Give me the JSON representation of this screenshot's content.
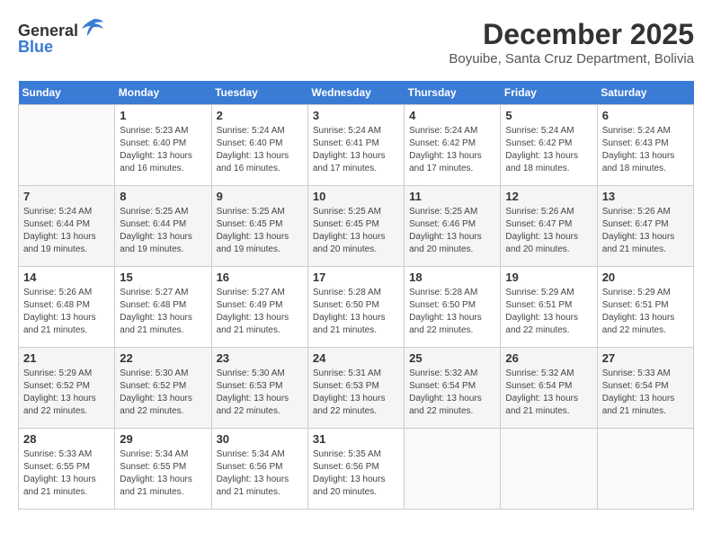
{
  "header": {
    "logo_general": "General",
    "logo_blue": "Blue",
    "month_title": "December 2025",
    "location": "Boyuibe, Santa Cruz Department, Bolivia"
  },
  "weekdays": [
    "Sunday",
    "Monday",
    "Tuesday",
    "Wednesday",
    "Thursday",
    "Friday",
    "Saturday"
  ],
  "weeks": [
    [
      {
        "day": "",
        "info": ""
      },
      {
        "day": "1",
        "info": "Sunrise: 5:23 AM\nSunset: 6:40 PM\nDaylight: 13 hours\nand 16 minutes."
      },
      {
        "day": "2",
        "info": "Sunrise: 5:24 AM\nSunset: 6:40 PM\nDaylight: 13 hours\nand 16 minutes."
      },
      {
        "day": "3",
        "info": "Sunrise: 5:24 AM\nSunset: 6:41 PM\nDaylight: 13 hours\nand 17 minutes."
      },
      {
        "day": "4",
        "info": "Sunrise: 5:24 AM\nSunset: 6:42 PM\nDaylight: 13 hours\nand 17 minutes."
      },
      {
        "day": "5",
        "info": "Sunrise: 5:24 AM\nSunset: 6:42 PM\nDaylight: 13 hours\nand 18 minutes."
      },
      {
        "day": "6",
        "info": "Sunrise: 5:24 AM\nSunset: 6:43 PM\nDaylight: 13 hours\nand 18 minutes."
      }
    ],
    [
      {
        "day": "7",
        "info": "Sunrise: 5:24 AM\nSunset: 6:44 PM\nDaylight: 13 hours\nand 19 minutes."
      },
      {
        "day": "8",
        "info": "Sunrise: 5:25 AM\nSunset: 6:44 PM\nDaylight: 13 hours\nand 19 minutes."
      },
      {
        "day": "9",
        "info": "Sunrise: 5:25 AM\nSunset: 6:45 PM\nDaylight: 13 hours\nand 19 minutes."
      },
      {
        "day": "10",
        "info": "Sunrise: 5:25 AM\nSunset: 6:45 PM\nDaylight: 13 hours\nand 20 minutes."
      },
      {
        "day": "11",
        "info": "Sunrise: 5:25 AM\nSunset: 6:46 PM\nDaylight: 13 hours\nand 20 minutes."
      },
      {
        "day": "12",
        "info": "Sunrise: 5:26 AM\nSunset: 6:47 PM\nDaylight: 13 hours\nand 20 minutes."
      },
      {
        "day": "13",
        "info": "Sunrise: 5:26 AM\nSunset: 6:47 PM\nDaylight: 13 hours\nand 21 minutes."
      }
    ],
    [
      {
        "day": "14",
        "info": "Sunrise: 5:26 AM\nSunset: 6:48 PM\nDaylight: 13 hours\nand 21 minutes."
      },
      {
        "day": "15",
        "info": "Sunrise: 5:27 AM\nSunset: 6:48 PM\nDaylight: 13 hours\nand 21 minutes."
      },
      {
        "day": "16",
        "info": "Sunrise: 5:27 AM\nSunset: 6:49 PM\nDaylight: 13 hours\nand 21 minutes."
      },
      {
        "day": "17",
        "info": "Sunrise: 5:28 AM\nSunset: 6:50 PM\nDaylight: 13 hours\nand 21 minutes."
      },
      {
        "day": "18",
        "info": "Sunrise: 5:28 AM\nSunset: 6:50 PM\nDaylight: 13 hours\nand 22 minutes."
      },
      {
        "day": "19",
        "info": "Sunrise: 5:29 AM\nSunset: 6:51 PM\nDaylight: 13 hours\nand 22 minutes."
      },
      {
        "day": "20",
        "info": "Sunrise: 5:29 AM\nSunset: 6:51 PM\nDaylight: 13 hours\nand 22 minutes."
      }
    ],
    [
      {
        "day": "21",
        "info": "Sunrise: 5:29 AM\nSunset: 6:52 PM\nDaylight: 13 hours\nand 22 minutes."
      },
      {
        "day": "22",
        "info": "Sunrise: 5:30 AM\nSunset: 6:52 PM\nDaylight: 13 hours\nand 22 minutes."
      },
      {
        "day": "23",
        "info": "Sunrise: 5:30 AM\nSunset: 6:53 PM\nDaylight: 13 hours\nand 22 minutes."
      },
      {
        "day": "24",
        "info": "Sunrise: 5:31 AM\nSunset: 6:53 PM\nDaylight: 13 hours\nand 22 minutes."
      },
      {
        "day": "25",
        "info": "Sunrise: 5:32 AM\nSunset: 6:54 PM\nDaylight: 13 hours\nand 22 minutes."
      },
      {
        "day": "26",
        "info": "Sunrise: 5:32 AM\nSunset: 6:54 PM\nDaylight: 13 hours\nand 21 minutes."
      },
      {
        "day": "27",
        "info": "Sunrise: 5:33 AM\nSunset: 6:54 PM\nDaylight: 13 hours\nand 21 minutes."
      }
    ],
    [
      {
        "day": "28",
        "info": "Sunrise: 5:33 AM\nSunset: 6:55 PM\nDaylight: 13 hours\nand 21 minutes."
      },
      {
        "day": "29",
        "info": "Sunrise: 5:34 AM\nSunset: 6:55 PM\nDaylight: 13 hours\nand 21 minutes."
      },
      {
        "day": "30",
        "info": "Sunrise: 5:34 AM\nSunset: 6:56 PM\nDaylight: 13 hours\nand 21 minutes."
      },
      {
        "day": "31",
        "info": "Sunrise: 5:35 AM\nSunset: 6:56 PM\nDaylight: 13 hours\nand 20 minutes."
      },
      {
        "day": "",
        "info": ""
      },
      {
        "day": "",
        "info": ""
      },
      {
        "day": "",
        "info": ""
      }
    ]
  ]
}
